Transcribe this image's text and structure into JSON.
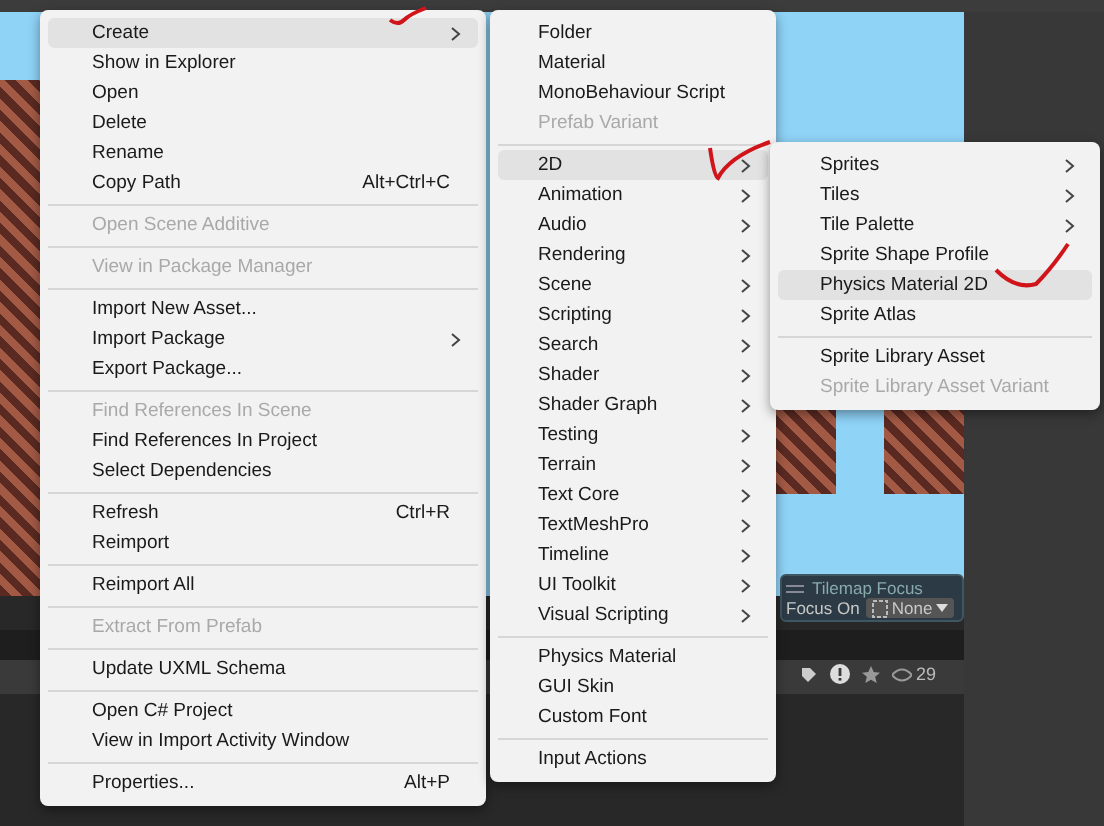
{
  "context_menu": {
    "items": [
      {
        "kind": "item",
        "label": "Create",
        "submenu": true,
        "selected": true,
        "disabled": false
      },
      {
        "kind": "item",
        "label": "Show in Explorer",
        "selected": false,
        "disabled": false
      },
      {
        "kind": "item",
        "label": "Open",
        "selected": false,
        "disabled": false
      },
      {
        "kind": "item",
        "label": "Delete",
        "selected": false,
        "disabled": false
      },
      {
        "kind": "item",
        "label": "Rename",
        "selected": false,
        "disabled": false
      },
      {
        "kind": "item",
        "label": "Copy Path",
        "shortcut": "Alt+Ctrl+C",
        "selected": false,
        "disabled": false
      },
      {
        "kind": "separator"
      },
      {
        "kind": "item",
        "label": "Open Scene Additive",
        "selected": false,
        "disabled": true
      },
      {
        "kind": "separator"
      },
      {
        "kind": "item",
        "label": "View in Package Manager",
        "selected": false,
        "disabled": true
      },
      {
        "kind": "separator"
      },
      {
        "kind": "item",
        "label": "Import New Asset...",
        "selected": false,
        "disabled": false
      },
      {
        "kind": "item",
        "label": "Import Package",
        "submenu": true,
        "selected": false,
        "disabled": false
      },
      {
        "kind": "item",
        "label": "Export Package...",
        "selected": false,
        "disabled": false
      },
      {
        "kind": "separator"
      },
      {
        "kind": "item",
        "label": "Find References In Scene",
        "selected": false,
        "disabled": true
      },
      {
        "kind": "item",
        "label": "Find References In Project",
        "selected": false,
        "disabled": false
      },
      {
        "kind": "item",
        "label": "Select Dependencies",
        "selected": false,
        "disabled": false
      },
      {
        "kind": "separator"
      },
      {
        "kind": "item",
        "label": "Refresh",
        "shortcut": "Ctrl+R",
        "selected": false,
        "disabled": false
      },
      {
        "kind": "item",
        "label": "Reimport",
        "selected": false,
        "disabled": false
      },
      {
        "kind": "separator"
      },
      {
        "kind": "item",
        "label": "Reimport All",
        "selected": false,
        "disabled": false
      },
      {
        "kind": "separator"
      },
      {
        "kind": "item",
        "label": "Extract From Prefab",
        "selected": false,
        "disabled": true
      },
      {
        "kind": "separator"
      },
      {
        "kind": "item",
        "label": "Update UXML Schema",
        "selected": false,
        "disabled": false
      },
      {
        "kind": "separator"
      },
      {
        "kind": "item",
        "label": "Open C# Project",
        "selected": false,
        "disabled": false
      },
      {
        "kind": "item",
        "label": "View in Import Activity Window",
        "selected": false,
        "disabled": false
      },
      {
        "kind": "separator"
      },
      {
        "kind": "item",
        "label": "Properties...",
        "shortcut": "Alt+P",
        "selected": false,
        "disabled": false
      }
    ]
  },
  "create_submenu": {
    "items": [
      {
        "kind": "item",
        "label": "Folder",
        "selected": false,
        "disabled": false
      },
      {
        "kind": "item",
        "label": "Material",
        "selected": false,
        "disabled": false
      },
      {
        "kind": "item",
        "label": "MonoBehaviour Script",
        "selected": false,
        "disabled": false
      },
      {
        "kind": "item",
        "label": "Prefab Variant",
        "selected": false,
        "disabled": true
      },
      {
        "kind": "separator"
      },
      {
        "kind": "item",
        "label": "2D",
        "submenu": true,
        "selected": true,
        "disabled": false
      },
      {
        "kind": "item",
        "label": "Animation",
        "submenu": true,
        "selected": false,
        "disabled": false
      },
      {
        "kind": "item",
        "label": "Audio",
        "submenu": true,
        "selected": false,
        "disabled": false
      },
      {
        "kind": "item",
        "label": "Rendering",
        "submenu": true,
        "selected": false,
        "disabled": false
      },
      {
        "kind": "item",
        "label": "Scene",
        "submenu": true,
        "selected": false,
        "disabled": false
      },
      {
        "kind": "item",
        "label": "Scripting",
        "submenu": true,
        "selected": false,
        "disabled": false
      },
      {
        "kind": "item",
        "label": "Search",
        "submenu": true,
        "selected": false,
        "disabled": false
      },
      {
        "kind": "item",
        "label": "Shader",
        "submenu": true,
        "selected": false,
        "disabled": false
      },
      {
        "kind": "item",
        "label": "Shader Graph",
        "submenu": true,
        "selected": false,
        "disabled": false
      },
      {
        "kind": "item",
        "label": "Testing",
        "submenu": true,
        "selected": false,
        "disabled": false
      },
      {
        "kind": "item",
        "label": "Terrain",
        "submenu": true,
        "selected": false,
        "disabled": false
      },
      {
        "kind": "item",
        "label": "Text Core",
        "submenu": true,
        "selected": false,
        "disabled": false
      },
      {
        "kind": "item",
        "label": "TextMeshPro",
        "submenu": true,
        "selected": false,
        "disabled": false
      },
      {
        "kind": "item",
        "label": "Timeline",
        "submenu": true,
        "selected": false,
        "disabled": false
      },
      {
        "kind": "item",
        "label": "UI Toolkit",
        "submenu": true,
        "selected": false,
        "disabled": false
      },
      {
        "kind": "item",
        "label": "Visual Scripting",
        "submenu": true,
        "selected": false,
        "disabled": false
      },
      {
        "kind": "separator"
      },
      {
        "kind": "item",
        "label": "Physics Material",
        "selected": false,
        "disabled": false
      },
      {
        "kind": "item",
        "label": "GUI Skin",
        "selected": false,
        "disabled": false
      },
      {
        "kind": "item",
        "label": "Custom Font",
        "selected": false,
        "disabled": false
      },
      {
        "kind": "separator"
      },
      {
        "kind": "item",
        "label": "Input Actions",
        "selected": false,
        "disabled": false
      }
    ]
  },
  "submenu_2d": {
    "items": [
      {
        "kind": "item",
        "label": "Sprites",
        "submenu": true,
        "selected": false,
        "disabled": false
      },
      {
        "kind": "item",
        "label": "Tiles",
        "submenu": true,
        "selected": false,
        "disabled": false
      },
      {
        "kind": "item",
        "label": "Tile Palette",
        "submenu": true,
        "selected": false,
        "disabled": false
      },
      {
        "kind": "item",
        "label": "Sprite Shape Profile",
        "selected": false,
        "disabled": false
      },
      {
        "kind": "item",
        "label": "Physics Material 2D",
        "selected": true,
        "disabled": false
      },
      {
        "kind": "item",
        "label": "Sprite Atlas",
        "selected": false,
        "disabled": false
      },
      {
        "kind": "separator"
      },
      {
        "kind": "item",
        "label": "Sprite Library Asset",
        "selected": false,
        "disabled": false
      },
      {
        "kind": "item",
        "label": "Sprite Library Asset Variant",
        "selected": false,
        "disabled": true
      }
    ]
  },
  "tilemap_focus": {
    "title": "Tilemap Focus",
    "label": "Focus On",
    "value": "None"
  },
  "project_toolbar": {
    "hidden_count": "29"
  }
}
